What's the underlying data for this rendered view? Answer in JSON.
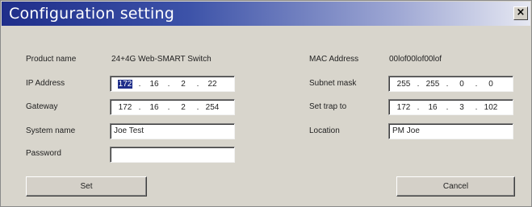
{
  "window": {
    "title": "Configuration setting",
    "close_glyph": "×"
  },
  "left": {
    "product_label": "Product name",
    "product_value": "24+4G Web-SMART Switch",
    "ip_label": "IP Address",
    "ip_octets": [
      "172",
      "16",
      "2",
      "22"
    ],
    "gateway_label": "Gateway",
    "gateway_octets": [
      "172",
      "16",
      "2",
      "254"
    ],
    "system_label": "System name",
    "system_value": "Joe Test",
    "password_label": "Password",
    "password_value": ""
  },
  "right": {
    "mac_label": "MAC Address",
    "mac_value": "00lof00lof00lof",
    "subnet_label": "Subnet mask",
    "subnet_octets": [
      "255",
      "255",
      "0",
      "0"
    ],
    "trap_label": "Set trap to",
    "trap_octets": [
      "172",
      "16",
      "3",
      "102"
    ],
    "location_label": "Location",
    "location_value": "PM Joe"
  },
  "buttons": {
    "set_label": "Set",
    "cancel_label": "Cancel"
  },
  "colors": {
    "title_gradient_start": "#1f2e8a",
    "dialog_bg": "#d8d5cc",
    "selection": "#1f2e8a"
  },
  "icons": {
    "close": "close-icon"
  }
}
